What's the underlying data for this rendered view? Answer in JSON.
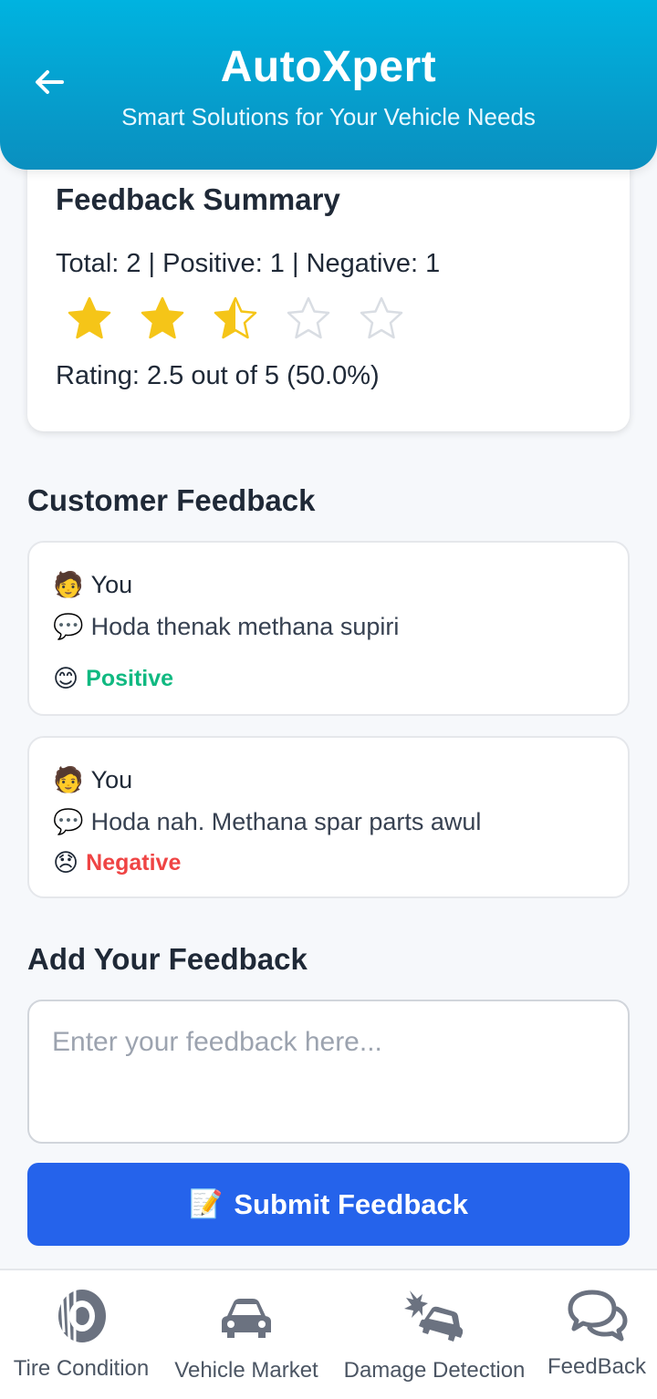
{
  "header": {
    "title": "AutoXpert",
    "subtitle": "Smart Solutions for Your Vehicle Needs",
    "back_icon": "arrow-left-icon"
  },
  "summary": {
    "title": "Feedback Summary",
    "counts": "Total: 2 | Positive: 1 | Negative: 1",
    "rating_value": 2.5,
    "rating_max": 5,
    "rating_text": "Rating: 2.5 out of 5 (50.0%)",
    "star_color": "#f5c518",
    "empty_star_color": "#d9dde3"
  },
  "customer_feedback": {
    "title": "Customer Feedback",
    "items": [
      {
        "user": "You",
        "user_emoji": "🧑",
        "text": "Hoda thenak  methana supiri",
        "text_emoji": "💬",
        "sentiment": "Positive",
        "sentiment_emoji": "😊",
        "sentiment_color": "#10b981"
      },
      {
        "user": "You",
        "user_emoji": "🧑",
        "text": "Hoda nah. Methana spar parts awul",
        "text_emoji": "💬",
        "sentiment": "Negative",
        "sentiment_emoji": "😞",
        "sentiment_color": "#ef4444"
      }
    ]
  },
  "add_feedback": {
    "title": "Add Your Feedback",
    "input_value": "",
    "placeholder": "Enter your feedback here...",
    "submit_emoji": "📝",
    "submit_label": "Submit Feedback",
    "submit_color": "#2563eb"
  },
  "bottom_nav": [
    {
      "label": "Tire Condition",
      "icon": "tire-icon"
    },
    {
      "label": "Vehicle Market",
      "icon": "car-icon"
    },
    {
      "label": "Damage Detection",
      "icon": "car-crash-icon"
    },
    {
      "label": "FeedBack",
      "icon": "chat-bubbles-icon"
    }
  ]
}
